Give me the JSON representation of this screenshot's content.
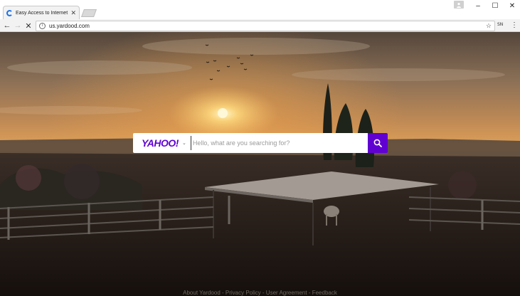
{
  "browser": {
    "tab_title": "Easy Access to Internet S",
    "tab_close": "✕",
    "url": "us.yardood.com",
    "extension_label": "SN",
    "window_controls": {
      "minimize": "–",
      "maximize": "☐",
      "close": "✕"
    },
    "nav": {
      "back": "←",
      "forward": "→",
      "stop": "✕"
    },
    "star": "☆",
    "menu": "⋮",
    "info": "i"
  },
  "search": {
    "logo_text": "YAHOO!",
    "logo_chevron": "⌄",
    "placeholder": "Hello, what are you searching for?",
    "value": "",
    "button_color": "#6001d2",
    "logo_color": "#5f01d1"
  },
  "footer": {
    "links": [
      "About Yardood",
      "Privacy Policy",
      "User Agreement",
      "Feedback"
    ],
    "separator": " - "
  },
  "icons": [
    "spinner-icon",
    "close-icon",
    "profile-icon",
    "back-icon",
    "forward-icon",
    "stop-icon",
    "info-icon",
    "star-icon",
    "menu-icon",
    "chevron-down-icon",
    "search-icon"
  ]
}
